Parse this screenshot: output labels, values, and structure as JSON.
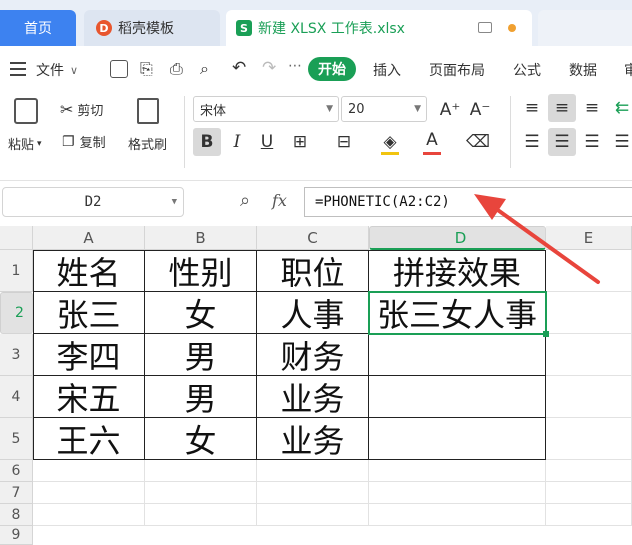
{
  "tabs": {
    "home": "首页",
    "template": "稻壳模板",
    "template_badge": "D",
    "file": "新建 XLSX 工作表.xlsx",
    "file_badge": "S"
  },
  "menu": {
    "file": "文件",
    "start": "开始",
    "insert": "插入",
    "layout": "页面布局",
    "formula": "公式",
    "data": "数据",
    "review": "审"
  },
  "toolbar": {
    "paste": "粘贴",
    "cut": "剪切",
    "copy": "复制",
    "format_painter": "格式刷",
    "font_name": "宋体",
    "font_size": "20",
    "grow": "A⁺",
    "shrink": "A⁻",
    "bold": "B",
    "italic": "I",
    "underline": "U"
  },
  "formula_bar": {
    "name_box": "D2",
    "fx": "fx",
    "formula": "=PHONETIC(A2:C2)"
  },
  "grid": {
    "columns": [
      "A",
      "B",
      "C",
      "D",
      "E"
    ],
    "rows": [
      "1",
      "2",
      "3",
      "4",
      "5",
      "6",
      "7",
      "8",
      "9"
    ],
    "cells": [
      [
        "姓名",
        "性别",
        "职位",
        "拼接效果"
      ],
      [
        "张三",
        "女",
        "人事",
        "张三女人事"
      ],
      [
        "李四",
        "男",
        "财务",
        ""
      ],
      [
        "宋五",
        "男",
        "业务",
        ""
      ],
      [
        "王六",
        "女",
        "业务",
        ""
      ]
    ],
    "selected": "D2"
  },
  "colors": {
    "accent_green": "#1a9f56",
    "tab_blue": "#3d82f0",
    "arrow_red": "#e8453c"
  }
}
